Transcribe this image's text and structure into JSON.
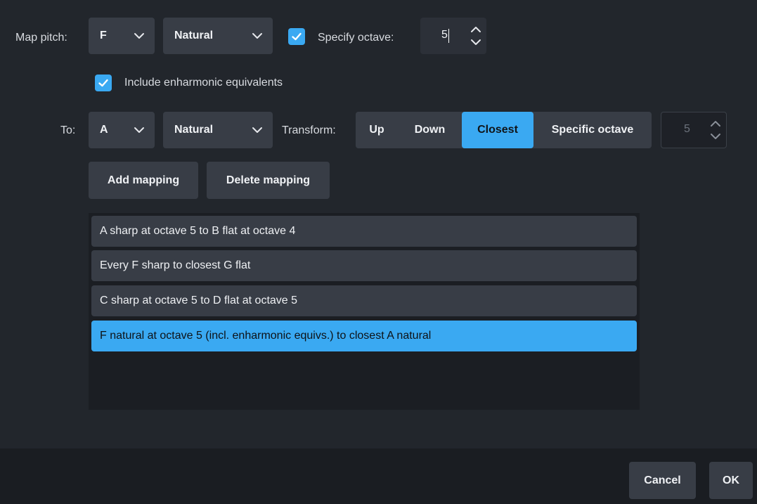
{
  "map_pitch": {
    "label": "Map pitch:",
    "note": "F",
    "accidental": "Natural",
    "specify_octave_label": "Specify octave:",
    "specify_octave_checked": true,
    "octave_value": "5"
  },
  "include_enharmonic": {
    "label": "Include enharmonic equivalents",
    "checked": true
  },
  "to": {
    "label": "To:",
    "note": "A",
    "accidental": "Natural",
    "transform_label": "Transform:",
    "transform_options": [
      "Up",
      "Down",
      "Closest",
      "Specific octave"
    ],
    "selected_transform": "Closest",
    "octave_value": "5"
  },
  "buttons": {
    "add_mapping": "Add mapping",
    "delete_mapping": "Delete mapping"
  },
  "mappings": [
    "A sharp at octave 5 to B flat at octave 4",
    "Every F sharp to closest G flat",
    "C sharp at octave 5 to D flat at octave 5",
    "F natural at octave 5 (incl. enharmonic equivs.) to closest A natural"
  ],
  "selected_mapping_index": 3,
  "footer": {
    "cancel": "Cancel",
    "ok": "OK"
  },
  "colors": {
    "accent": "#3aa9f2",
    "background": "#22262c",
    "control": "#383d46",
    "list_background": "#1b1e23"
  },
  "icons": {
    "dropdown": "chevron-down-icon",
    "checkbox": "checkmark-icon",
    "spin_up": "chevron-up-icon",
    "spin_down": "chevron-down-icon"
  }
}
